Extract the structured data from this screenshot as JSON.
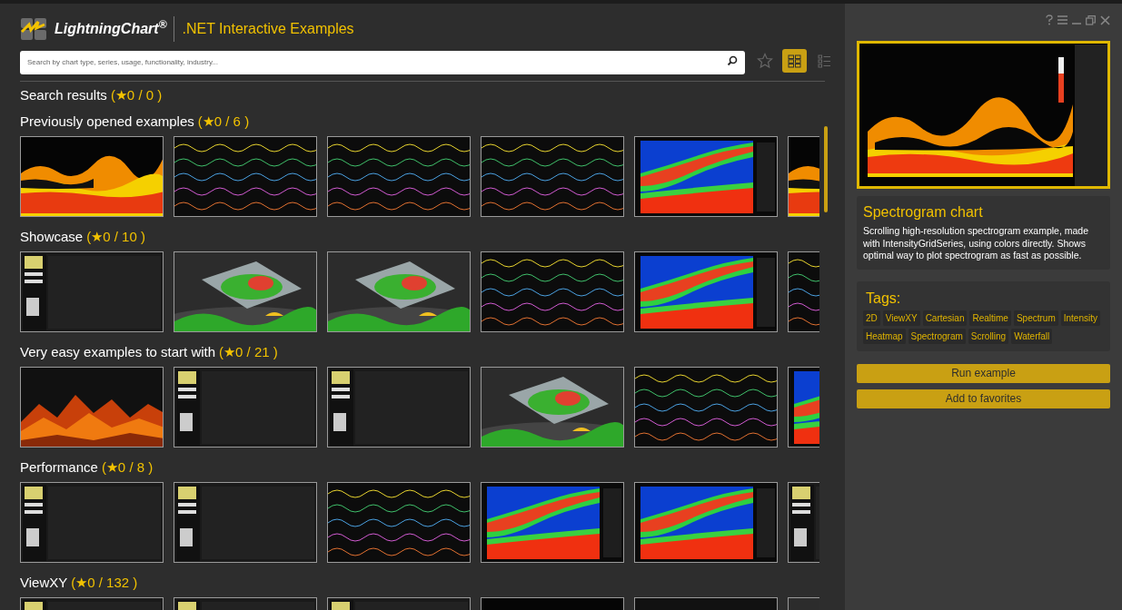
{
  "header": {
    "logo_text": "LightningChart$^{®}$",
    "title": ".NET Interactive Examples"
  },
  "search": {
    "placeholder": "Search by chart type, series, usage, functionality, industry..."
  },
  "view_buttons": [
    {
      "kind": "favorites",
      "selected": false
    },
    {
      "kind": "grid",
      "selected": true
    },
    {
      "kind": "list",
      "selected": false
    }
  ],
  "sections": [
    {
      "title": "Search results",
      "count": "(★0 / 0 )"
    },
    {
      "title": "Previously opened examples",
      "count": "(★0 / 6 )"
    },
    {
      "title": "Showcase",
      "count": "(★0 / 10 )"
    },
    {
      "title": "Very easy examples to start with",
      "count": "(★0 / 21 )"
    },
    {
      "title": "Performance",
      "count": "(★0 / 8 )"
    },
    {
      "title": "ViewXY",
      "count": "(★0 / 132 )"
    }
  ],
  "detail": {
    "title": "Spectrogram chart",
    "description": "Scrolling high-resolution spectrogram example, made with IntensityGridSeries, using colors directly. Shows optimal way to plot spectrogram as fast as possible.",
    "tags_heading": "Tags:",
    "tags": [
      "2D",
      "ViewXY",
      "Cartesian",
      "Realtime",
      "Spectrum",
      "Intensity",
      "Heatmap",
      "Spectrogram",
      "Scrolling",
      "Waterfall"
    ],
    "buttons": [
      "Run example",
      "Add to favorites"
    ]
  }
}
